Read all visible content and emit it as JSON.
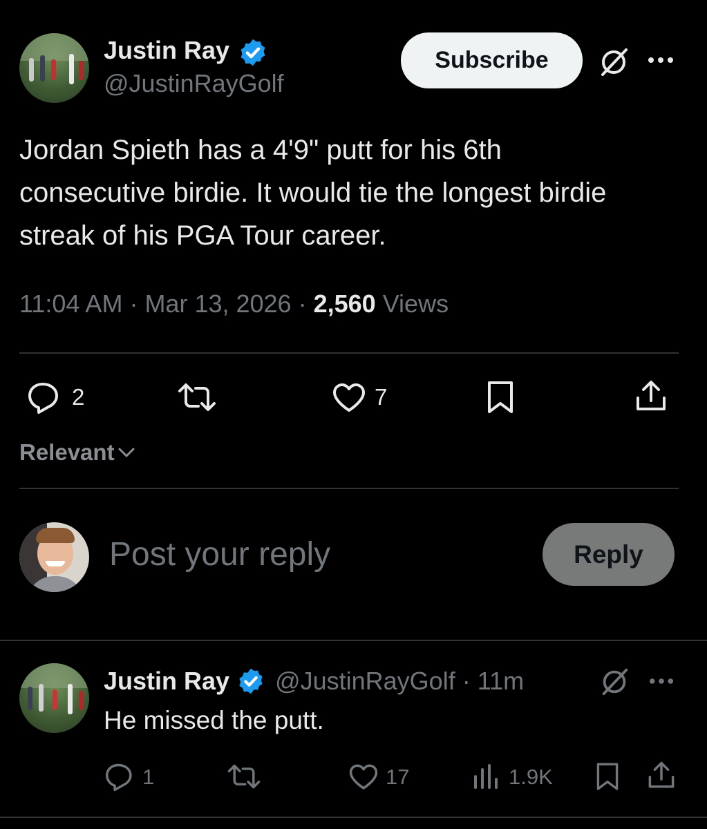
{
  "main_post": {
    "author_name": "Justin Ray",
    "handle": "@JustinRayGolf",
    "subscribe_label": "Subscribe",
    "text": "Jordan Spieth has a 4'9\" putt for his 6th consecutive birdie. It would tie the longest birdie streak of his PGA Tour career.",
    "time": "11:04 AM",
    "date": "Mar 13, 2026",
    "views_count": "2,560",
    "views_label": "Views",
    "replies": "2",
    "likes": "7"
  },
  "sort": {
    "label": "Relevant"
  },
  "composer": {
    "placeholder": "Post your reply",
    "reply_label": "Reply"
  },
  "reply_post": {
    "author_name": "Justin Ray",
    "handle": "@JustinRayGolf",
    "age": "11m",
    "text": "He missed the putt.",
    "replies": "1",
    "likes": "17",
    "views": "1.9K"
  },
  "colors": {
    "background": "#000000",
    "text": "#e7e9ea",
    "muted": "#71767b",
    "verified": "#1d9bf0",
    "divider": "#2f3336"
  }
}
